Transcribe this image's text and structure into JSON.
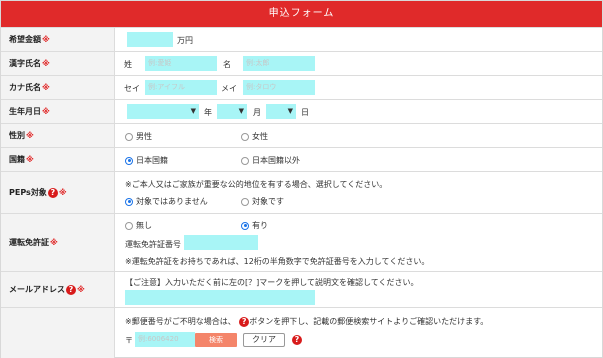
{
  "form_title": "申込フォーム",
  "required_mark": "※",
  "help_glyph": "?",
  "amount": {
    "label": "希望金額",
    "unit": "万円"
  },
  "kanji_name": {
    "label": "漢字氏名",
    "sei_label": "姓",
    "sei_placeholder": "例:愛姫",
    "mei_label": "名",
    "mei_placeholder": "例:太郎"
  },
  "kana_name": {
    "label": "カナ氏名",
    "sei_label": "セイ",
    "sei_placeholder": "例:アイフル",
    "mei_label": "メイ",
    "mei_placeholder": "例:タロウ"
  },
  "birthdate": {
    "label": "生年月日",
    "year_unit": "年",
    "month_unit": "月",
    "day_unit": "日"
  },
  "gender": {
    "label": "性別",
    "options": [
      "男性",
      "女性"
    ],
    "selected": null
  },
  "nationality": {
    "label": "国籍",
    "options": [
      "日本国籍",
      "日本国籍以外"
    ],
    "selected": "日本国籍"
  },
  "peps": {
    "label": "PEPs対象",
    "note": "※ご本人又はご家族が重要な公的地位を有する場合、選択してください。",
    "options": [
      "対象ではありません",
      "対象です"
    ],
    "selected": "対象ではありません"
  },
  "license": {
    "label": "運転免許証",
    "options": [
      "無し",
      "有り"
    ],
    "selected": "有り",
    "number_label": "運転免許証番号",
    "note": "※運転免許証をお持ちであれば、12桁の半角数字で免許証番号を入力してください。"
  },
  "email": {
    "label": "メールアドレス",
    "note": "【ご注意】入力いただく前に左の[？]マークを押して説明文を確認してください。"
  },
  "address": {
    "note_before": "※郵便番号がご不明な場合は、",
    "note_after": "ボタンを押下し、記載の郵便検索サイトよりご確認いただけます。",
    "postal_mark": "〒",
    "postal_placeholder": "例:6006420",
    "search_button": "検索",
    "clear_button": "クリア"
  },
  "colors": {
    "header": "#e02a2a",
    "input_fill": "#a8f5f6",
    "search_button": "#f4856a",
    "help_icon": "#d81b1b"
  }
}
